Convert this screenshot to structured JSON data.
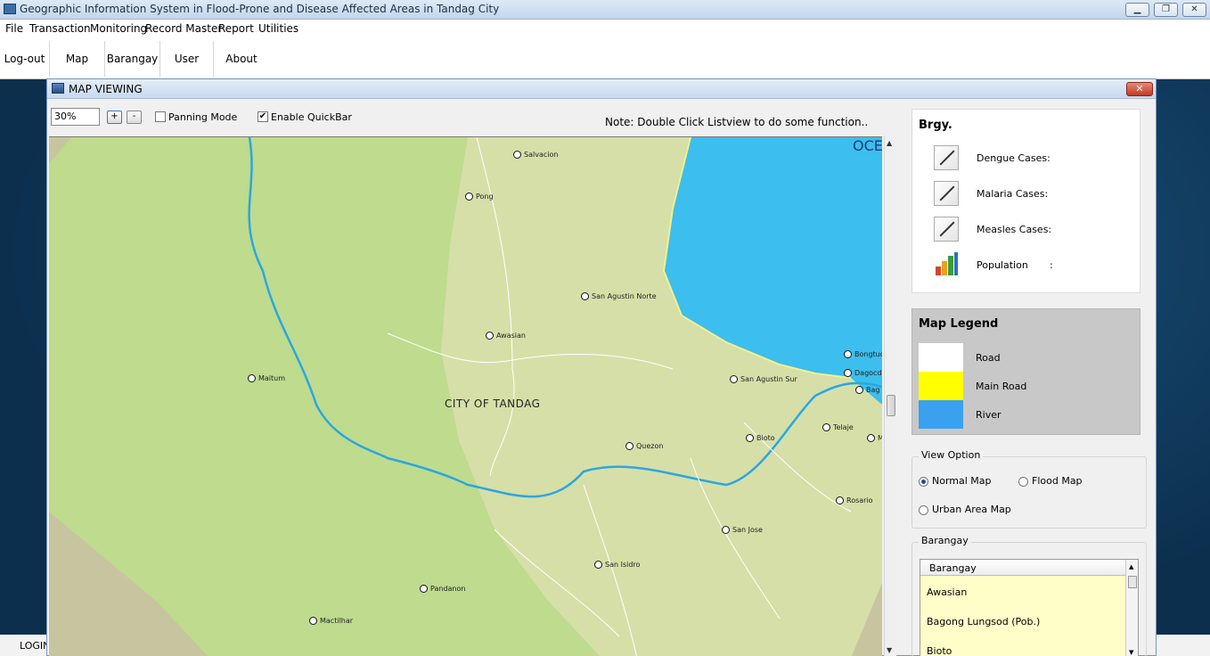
{
  "app": {
    "title": "Geographic Information System in Flood-Prone and Disease Affected Areas in Tandag City",
    "window_controls": [
      "minimize-icon",
      "restore-icon",
      "close-icon"
    ]
  },
  "menu": {
    "items": [
      "File",
      "Transaction",
      "Monitoring",
      "Record Master",
      "Report",
      "Utilities"
    ]
  },
  "toolbar": {
    "logout": "Log-out",
    "map": "Map",
    "barangay": "Barangay",
    "user": "User",
    "about": "About"
  },
  "status": {
    "login": "LOGIN"
  },
  "map_window": {
    "title": "MAP VIEWING",
    "zoom_value": "30%",
    "zoom_in": "+",
    "zoom_out": "-",
    "panning_mode": {
      "label": "Panning Mode",
      "checked": false
    },
    "enable_quickbar": {
      "label": "Enable QuickBar",
      "checked": true
    },
    "note": "Note: Double Click Listview to do some function.."
  },
  "map": {
    "city_label": "CITY OF TANDAG",
    "ocean_label": "OCE",
    "colors": {
      "land": "#bedb8e",
      "upland": "#d6dfa8",
      "edge": "#c7c59f",
      "water": "#3cbeee",
      "river": "#2aa7e0",
      "coast_road": "#f5f08a"
    },
    "places": [
      "Salvacion",
      "Pong",
      "San Agustin Norte",
      "Awasian",
      "Maitum",
      "San Agustin Sur",
      "Bongtud",
      "Dagocdoc",
      "Bag",
      "Telaje",
      "M",
      "Bioto",
      "Quezon",
      "Rosario",
      "San Jose",
      "San Isidro",
      "Pandanon",
      "Mactilhar"
    ]
  },
  "info": {
    "heading": "Brgy.",
    "dengue": "Dengue Cases:",
    "malaria": "Malaria Cases:",
    "measles": "Measles Cases:",
    "population": "Population",
    "population_sep": ":"
  },
  "legend": {
    "title": "Map Legend",
    "items": [
      {
        "label": "Road",
        "color": "#ffffff"
      },
      {
        "label": "Main Road",
        "color": "#ffff00"
      },
      {
        "label": "River",
        "color": "#3aa0f0"
      }
    ]
  },
  "view_option": {
    "title": "View Option",
    "normal": "Normal Map",
    "flood": "Flood Map",
    "urban": "Urban Area Map",
    "selected": "Normal Map"
  },
  "barangay_list": {
    "title": "Barangay",
    "column": "Barangay",
    "items": [
      "Awasian",
      "Bagong Lungsod (Pob.)",
      "Bioto"
    ]
  }
}
